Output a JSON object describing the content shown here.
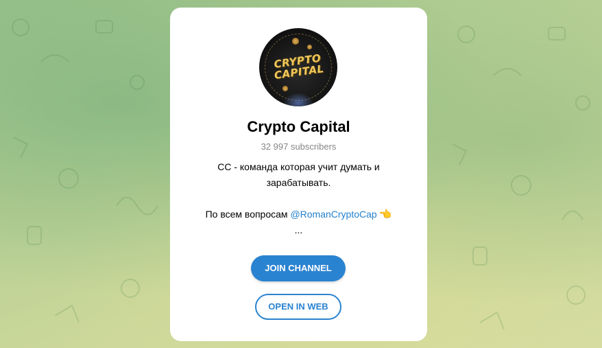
{
  "channel": {
    "avatar_logo_line1": "CRYPTO",
    "avatar_logo_line2": "CAPITAL",
    "title": "Crypto Capital",
    "subscribers": "32 997 subscribers",
    "description_line1": "CC - команда которая учит думать и",
    "description_line2": "зарабатывать.",
    "description_contact_prefix": "По всем вопросам ",
    "description_contact_link": "@RomanCryptoCap",
    "description_hand_icon": "👈",
    "description_ellipsis": "..."
  },
  "buttons": {
    "join_label": "JOIN CHANNEL",
    "open_web_label": "OPEN IN WEB"
  },
  "colors": {
    "accent": "#2a83d0",
    "link": "#2481cc",
    "subtle_text": "#868686"
  },
  "icons": {
    "hand": "pointing-left-hand-icon"
  }
}
